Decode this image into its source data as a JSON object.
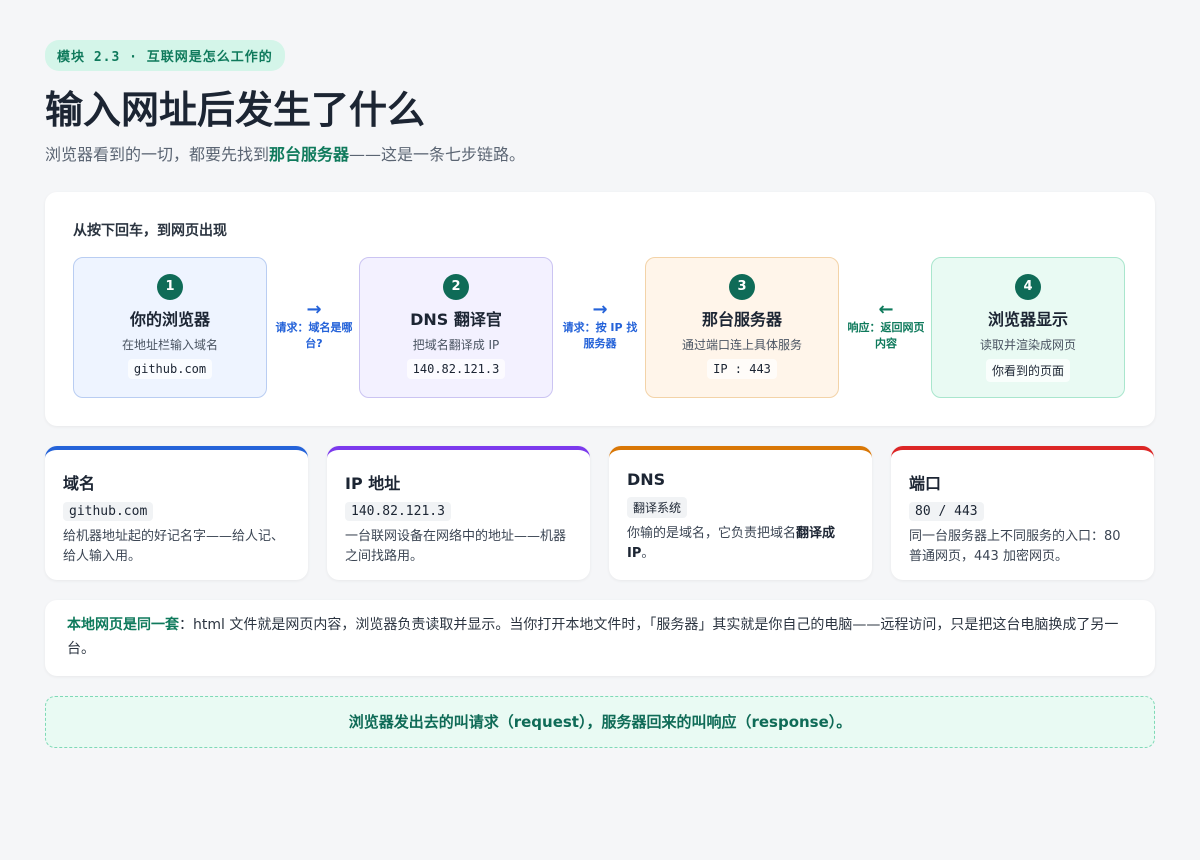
{
  "header": {
    "badge": "模块 2.3 · 互联网是怎么工作的",
    "title": "输入网址后发生了什么",
    "subtitle_before": "浏览器看到的一切，都要先找到",
    "subtitle_highlight": "那台服务器",
    "subtitle_after": "——这是一条七步链路。"
  },
  "flow": {
    "title": "从按下回车，到网页出现",
    "steps": [
      {
        "num": "1",
        "name": "你的浏览器",
        "desc": "在地址栏输入域名",
        "code": "github.com"
      },
      {
        "num": "2",
        "name": "DNS 翻译官",
        "desc": "把域名翻译成 IP",
        "code": "140.82.121.3"
      },
      {
        "num": "3",
        "name": "那台服务器",
        "desc": "通过端口连上具体服务",
        "code": "IP : 443"
      },
      {
        "num": "4",
        "name": "浏览器显示",
        "desc": "读取并渲染成网页",
        "code": "你看到的页面"
      }
    ],
    "arrows": [
      {
        "glyph": "→",
        "label": "请求：域名是哪台?"
      },
      {
        "glyph": "→",
        "label": "请求：按 IP 找服务器"
      },
      {
        "glyph": "←",
        "label": "响应：返回网页内容"
      }
    ]
  },
  "terms": [
    {
      "title": "域名",
      "code": "github.com",
      "desc": "给机器地址起的好记名字——给人记、给人输入用。"
    },
    {
      "title": "IP 地址",
      "code": "140.82.121.3",
      "desc": "一台联网设备在网络中的地址——机器之间找路用。"
    },
    {
      "title": "DNS",
      "code": "翻译系统",
      "desc_before": "你输的是域名，它负责把域名",
      "desc_bold": "翻译成 IP",
      "desc_after": "。"
    },
    {
      "title": "端口",
      "code": "80 / 443",
      "desc": "同一台服务器上不同服务的入口：80 普通网页，443 加密网页。"
    }
  ],
  "note": {
    "label": "本地网页是同一套",
    "text": "：html 文件就是网页内容，浏览器负责读取并显示。当你打开本地文件时，「服务器」其实就是你自己的电脑——远程访问，只是把这台电脑换成了另一台。"
  },
  "footer": "浏览器发出去的叫请求（request），服务器回来的叫响应（response）。"
}
